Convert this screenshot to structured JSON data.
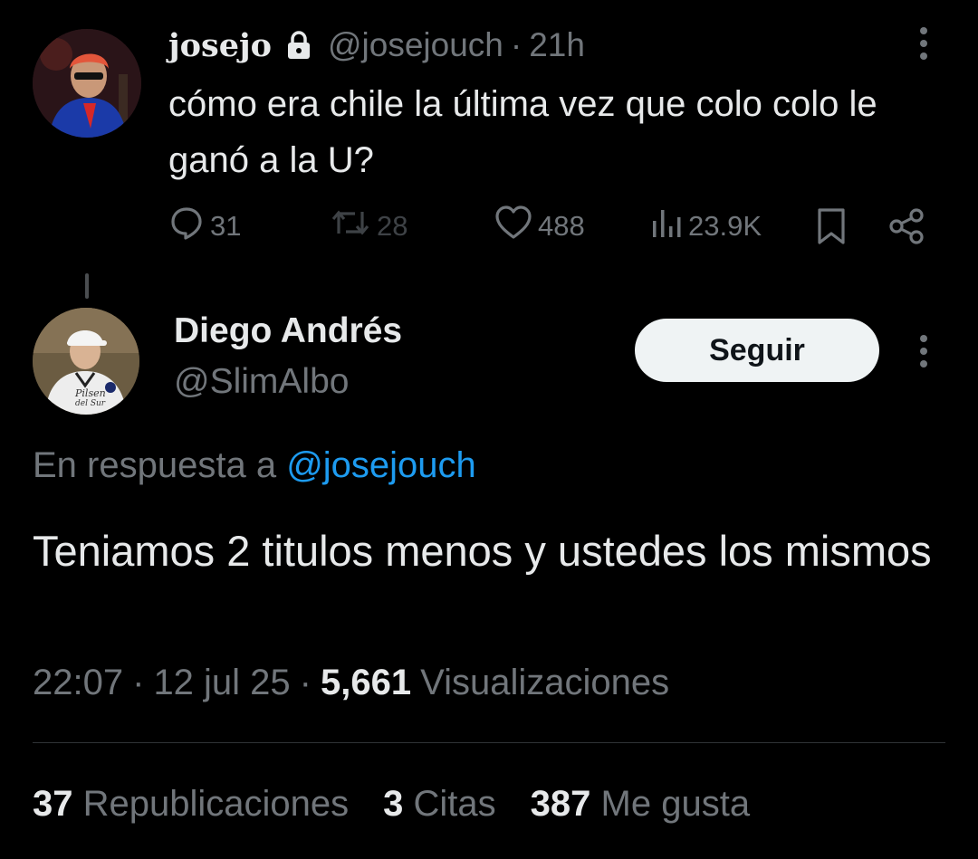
{
  "parent_tweet": {
    "display_name": "josejo",
    "handle": "@josejouch",
    "separator": "·",
    "time": "21h",
    "text": "cómo era chile la última vez que colo colo le ganó a la U?",
    "actions": {
      "replies": "31",
      "retweets": "28",
      "likes": "488",
      "views": "23.9K"
    },
    "icons": [
      "lock-icon",
      "more-icon",
      "reply-icon",
      "retweet-icon",
      "like-icon",
      "views-icon",
      "bookmark-icon",
      "share-icon"
    ]
  },
  "reply_tweet": {
    "display_name": "Diego Andrés",
    "handle": "@SlimAlbo",
    "follow_label": "Seguir",
    "reply_prefix": "En respuesta a",
    "reply_to": "@josejouch",
    "text": "Teniamos 2 titulos menos y ustedes los mismos",
    "time": "22:07",
    "separator": "·",
    "date": "12 jul 25",
    "view_count": "5,661",
    "view_label": "Visualizaciones",
    "avatar_text": "Pilsen del Sur",
    "stats": {
      "reposts_count": "37",
      "reposts_label": "Republicaciones",
      "quotes_count": "3",
      "quotes_label": "Citas",
      "likes_count": "387",
      "likes_label": "Me gusta"
    }
  },
  "colors": {
    "background": "#000000",
    "text": "#e7e9ea",
    "muted": "#71767b",
    "link": "#1d9bf0",
    "button_bg": "#eff3f4",
    "button_text": "#0f1419"
  }
}
